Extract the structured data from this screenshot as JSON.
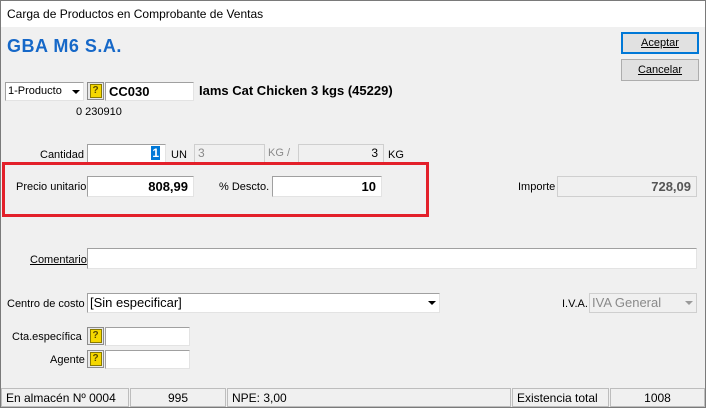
{
  "window": {
    "title": "Carga de Productos en Comprobante de Ventas"
  },
  "company": "GBA M6 S.A.",
  "buttons": {
    "accept": "Aceptar",
    "cancel": "Cancelar"
  },
  "product": {
    "type_value": "1-Producto",
    "help_glyph": "?",
    "code": "CC030",
    "description": "Iams Cat Chicken 3 kgs (45229)",
    "sub_info": "0 230910"
  },
  "quantity": {
    "label": "Cantidad",
    "value": "1",
    "unit": "UN",
    "weight_value": "3",
    "weight_unit_a": "KG /",
    "weight_value_b": "3",
    "weight_unit_b": "KG"
  },
  "price": {
    "unit_label": "Precio unitario",
    "unit_value": "808,99",
    "discount_label": "% Descto.",
    "discount_value": "10",
    "amount_label": "Importe",
    "amount_value": "728,09"
  },
  "comment": {
    "label": "Comentario",
    "value": ""
  },
  "cost_center": {
    "label": "Centro de costo",
    "value": "[Sin especificar]"
  },
  "iva": {
    "label": "I.V.A.",
    "value": "IVA General"
  },
  "account": {
    "label": "Cta.específica",
    "value": ""
  },
  "agent": {
    "label": "Agente",
    "value": ""
  },
  "status": {
    "warehouse_label": "En almacén Nº 0004",
    "warehouse_value": "995",
    "npe": "NPE: 3,00",
    "total_label": "Existencia total",
    "total_value": "1008"
  },
  "colors": {
    "company": "#1668c8",
    "highlight": "#e3202a",
    "selection": "#0078d7"
  }
}
